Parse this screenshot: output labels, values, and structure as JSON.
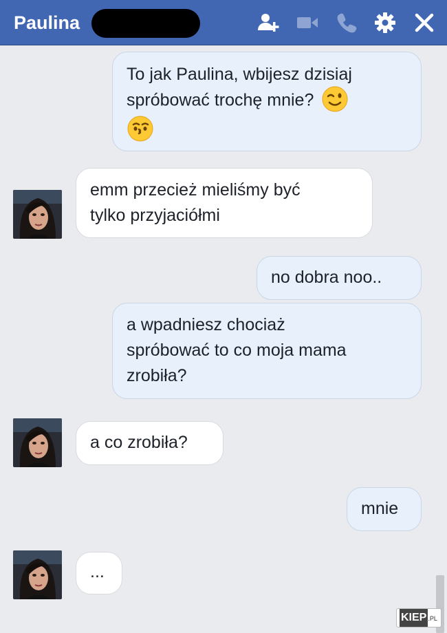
{
  "header": {
    "contact_name": "Paulina",
    "icons": [
      "add-person-icon",
      "video-call-icon",
      "phone-icon",
      "gear-icon",
      "close-icon"
    ],
    "background": "#4267b2"
  },
  "messages": [
    {
      "from": "me",
      "lines": [
        "To jak Paulina, wbijesz dzisiaj",
        "spróbować trochę mnie?"
      ],
      "emojis": [
        "winking-face",
        "kissing-face"
      ]
    },
    {
      "from": "contact",
      "lines": [
        "emm przecież mieliśmy być",
        "tylko przyjaciółmi"
      ]
    },
    {
      "from": "me",
      "lines": [
        "no dobra noo.."
      ]
    },
    {
      "from": "me",
      "lines": [
        "a wpadniesz chociaż",
        "spróbować to co moja mama",
        "zrobiła?"
      ]
    },
    {
      "from": "contact",
      "lines": [
        "a co zrobiła?"
      ]
    },
    {
      "from": "me",
      "lines": [
        "mnie"
      ]
    },
    {
      "from": "contact",
      "lines": [
        "..."
      ]
    }
  ],
  "colors": {
    "outgoing_bubble": "#e7f0fb",
    "incoming_bubble": "#ffffff",
    "chat_background": "#e9ebee"
  },
  "watermark": {
    "main": "KIEP",
    "suffix": ".PL"
  }
}
